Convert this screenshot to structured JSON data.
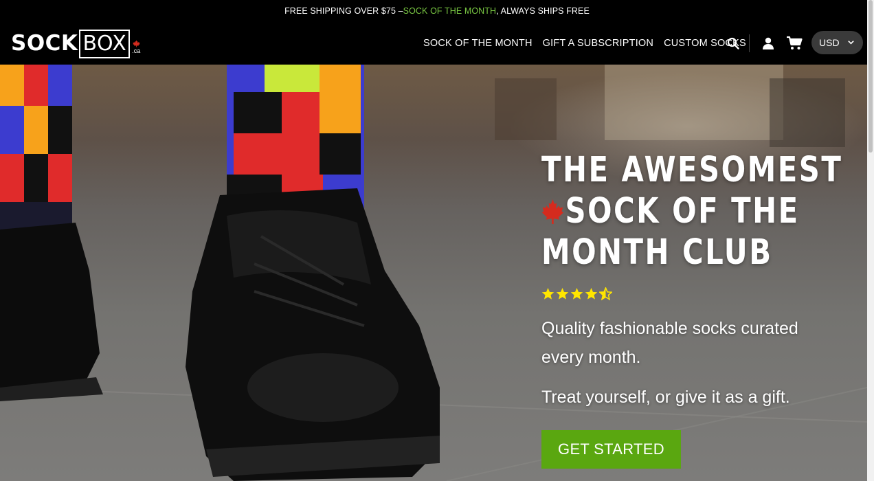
{
  "announcement": {
    "prefix": "FREE SHIPPING OVER $75 – ",
    "highlight": "SOCK OF THE MONTH",
    "suffix": ", ALWAYS SHIPS FREE",
    "highlight_color": "#7ac943"
  },
  "logo": {
    "part1": "SOCK",
    "part2": "BOX",
    "tld": ".ca"
  },
  "nav": {
    "items": [
      {
        "label": "SOCK OF THE MONTH"
      },
      {
        "label": "GIFT A SUBSCRIPTION"
      },
      {
        "label": "CUSTOM SOCKS"
      }
    ],
    "icons": [
      "search-icon",
      "account-icon",
      "cart-icon"
    ]
  },
  "currency": {
    "selected": "USD"
  },
  "hero": {
    "headline_line1": "THE AWESOMEST",
    "headline_line2": "SOCK OF THE",
    "headline_line3": "MONTH CLUB",
    "rating": 4.5,
    "rating_max": 5,
    "star_color": "#ffe600",
    "subtitle": "Quality fashionable socks curated every month.",
    "subtitle2": "Treat yourself, or give it as a gift.",
    "cta": "GET STARTED",
    "cta_color": "#5aa710",
    "maple_leaf_color": "#d52b1e"
  }
}
